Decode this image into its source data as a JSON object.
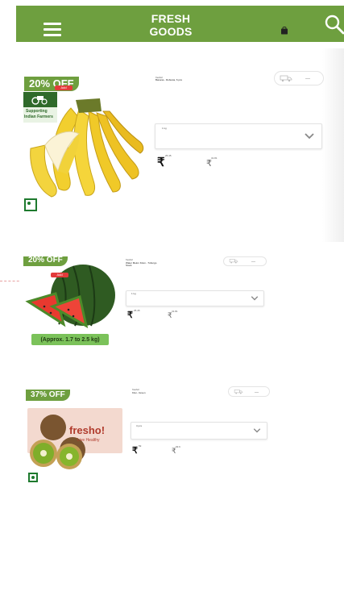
{
  "header": {
    "title": "FRESH GOODS",
    "menu_icon": "hamburger-menu-icon",
    "cart_icon": "shopping-bag-icon",
    "search_icon": "search-icon",
    "background": "#6e9f3f"
  },
  "products": [
    {
      "discount": "20% OFF",
      "tag": "Add",
      "brand": "fresho!",
      "name": "Banana - Robusta, 6 pcs",
      "quantity": "1 kg",
      "price": "25.45",
      "mrp": "31.81",
      "banner_lines": [
        "Supporting",
        "Indian Farmers"
      ]
    },
    {
      "discount": "20% OFF",
      "tag": "Add",
      "brand": "fresho!",
      "name": "Water Melon Kiran - Tuburgo Stock",
      "quantity": "1 kg",
      "price": "25.45",
      "mrp": "31.81",
      "image_caption": "(Approx. 1.7 to 2.5 kg)"
    },
    {
      "discount": "37% OFF",
      "tag": "",
      "brand": "fresho!",
      "name": "Kiwi - Green",
      "quantity": "3 pcs",
      "price": "59",
      "mrp": "93.6",
      "pack_brand": "fresho!",
      "pack_tagline": "Live Healthy"
    }
  ]
}
